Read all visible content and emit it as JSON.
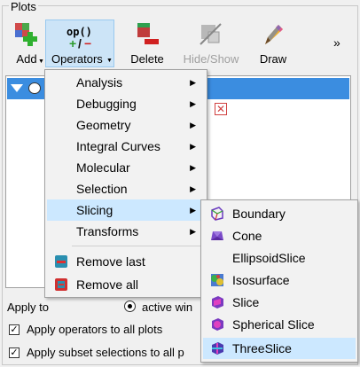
{
  "panel": {
    "title": "Plots"
  },
  "toolbar": {
    "add_label": "Add",
    "operators_label": "Operators",
    "operators_icon_text": "op()",
    "delete_label": "Delete",
    "hideshow_label": "Hide/Show",
    "draw_label": "Draw",
    "more_label": "»"
  },
  "operators_menu": {
    "items": [
      {
        "label": "Analysis",
        "submenu": true
      },
      {
        "label": "Debugging",
        "submenu": true
      },
      {
        "label": "Geometry",
        "submenu": true
      },
      {
        "label": "Integral Curves",
        "submenu": true
      },
      {
        "label": "Molecular",
        "submenu": true
      },
      {
        "label": "Selection",
        "submenu": true
      },
      {
        "label": "Slicing",
        "submenu": true,
        "highlighted": true
      },
      {
        "label": "Transforms",
        "submenu": true
      }
    ],
    "remove_last": "Remove last",
    "remove_all": "Remove all"
  },
  "slicing_menu": {
    "items": [
      {
        "label": "Boundary",
        "icon": "boundary-icon"
      },
      {
        "label": "Cone",
        "icon": "cone-icon"
      },
      {
        "label": "EllipsoidSlice",
        "icon": ""
      },
      {
        "label": "Isosurface",
        "icon": "isosurface-icon"
      },
      {
        "label": "Slice",
        "icon": "slice-icon"
      },
      {
        "label": "Spherical Slice",
        "icon": "spherical-slice-icon"
      },
      {
        "label": "ThreeSlice",
        "icon": "threeslice-icon",
        "highlighted": true
      }
    ]
  },
  "bottom": {
    "apply_to_label": "Apply to",
    "active_window_label": "active win",
    "apply_operators_label": "Apply operators to all plots",
    "apply_subset_label": "Apply subset selections to all p"
  },
  "colors": {
    "selection_blue": "#3b8de0",
    "menu_highlight": "#cce8ff",
    "toolbar_pressed": "#cce4f7"
  }
}
